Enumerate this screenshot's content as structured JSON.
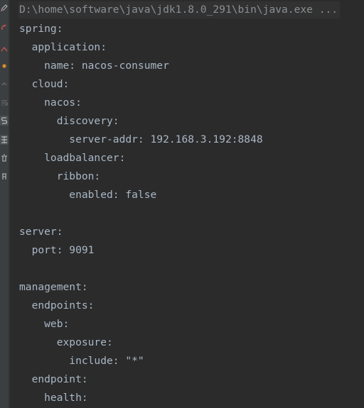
{
  "console": {
    "command": "D:\\home\\software\\java\\jdk1.8.0_291\\bin\\java.exe ...",
    "lines": [
      "spring:",
      "  application:",
      "    name: nacos-consumer",
      "  cloud:",
      "    nacos:",
      "      discovery:",
      "        server-addr: 192.168.3.192:8848",
      "    loadbalancer:",
      "      ribbon:",
      "        enabled: false",
      "",
      "server:",
      "  port: 9091",
      "",
      "management:",
      "  endpoints:",
      "    web:",
      "      exposure:",
      "        include: \"*\"",
      "  endpoint:",
      "    health:"
    ]
  },
  "toolbar": {
    "icons": [
      "edit-icon",
      "rerun-icon",
      "stop-icon",
      "settings-icon",
      "scroll-up-icon",
      "soft-wrap-icon",
      "scroll-to-end-icon",
      "print-icon",
      "trash-icon"
    ],
    "colors": {
      "background": "#2b2b2b",
      "gutter": "#3c3f41",
      "text": "#a9b7c6",
      "command_text": "#8a8f94",
      "command_highlight": "#323232",
      "accent_red": "#c75450",
      "accent_orange": "#e08a2b"
    }
  }
}
